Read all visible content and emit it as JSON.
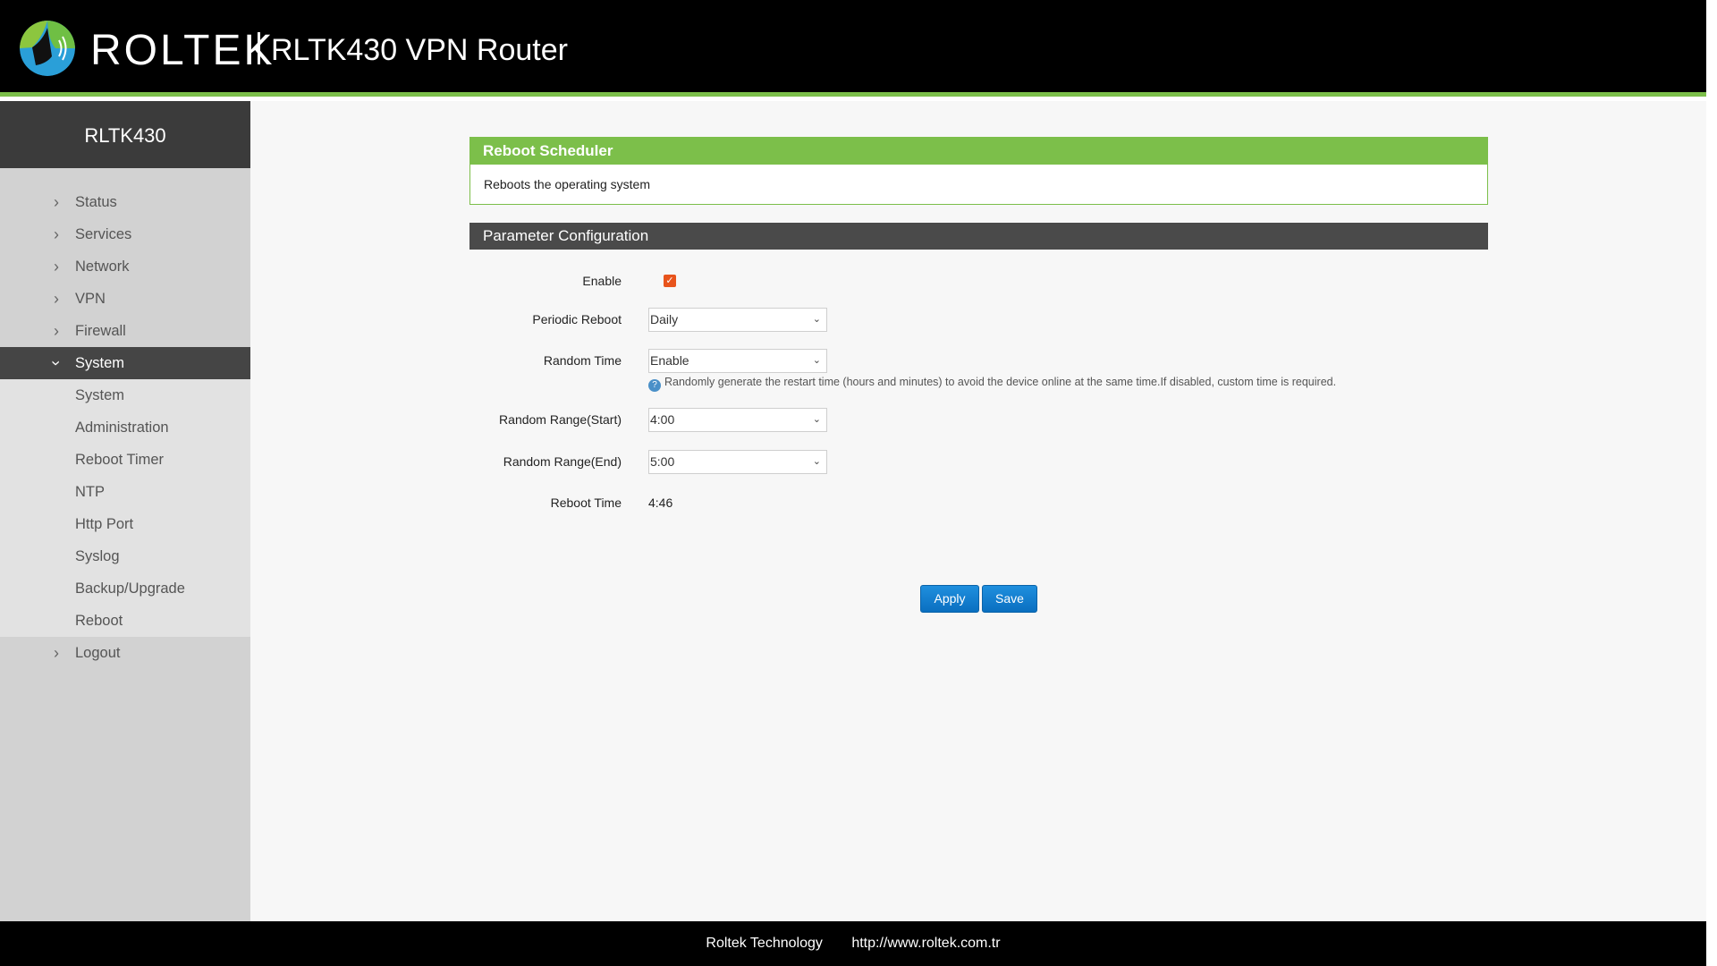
{
  "header": {
    "brand": "ROLTEK",
    "product": "RLTK430 VPN Router",
    "logo_icon": "roltek-logo-icon"
  },
  "sidebar": {
    "device_name": "RLTK430",
    "items": [
      {
        "label": "Status"
      },
      {
        "label": "Services"
      },
      {
        "label": "Network"
      },
      {
        "label": "VPN"
      },
      {
        "label": "Firewall"
      },
      {
        "label": "System"
      },
      {
        "label": "Logout"
      }
    ],
    "system_submenu": [
      {
        "label": "System"
      },
      {
        "label": "Administration"
      },
      {
        "label": "Reboot Timer"
      },
      {
        "label": "NTP"
      },
      {
        "label": "Http Port"
      },
      {
        "label": "Syslog"
      },
      {
        "label": "Backup/Upgrade"
      },
      {
        "label": "Reboot"
      }
    ]
  },
  "main": {
    "panel_title": "Reboot Scheduler",
    "panel_desc": "Reboots the operating system",
    "config_title": "Parameter Configuration",
    "fields": {
      "enable_label": "Enable",
      "enable_checked": true,
      "periodic_label": "Periodic Reboot",
      "periodic_value": "Daily",
      "random_time_label": "Random Time",
      "random_time_value": "Enable",
      "random_time_hint": "Randomly generate the restart time (hours and minutes) to avoid the device online at the same time.If disabled, custom time is required.",
      "range_start_label": "Random Range(Start)",
      "range_start_value": "4:00",
      "range_end_label": "Random Range(End)",
      "range_end_value": "5:00",
      "reboot_time_label": "Reboot Time",
      "reboot_time_value": "4:46"
    },
    "buttons": {
      "apply": "Apply",
      "save": "Save"
    }
  },
  "footer": {
    "company": "Roltek Technology",
    "url": "http://www.roltek.com.tr"
  },
  "colors": {
    "accent_green": "#7cbf4a",
    "button_blue": "#0a6fc0",
    "checkbox_orange": "#e8541c"
  }
}
